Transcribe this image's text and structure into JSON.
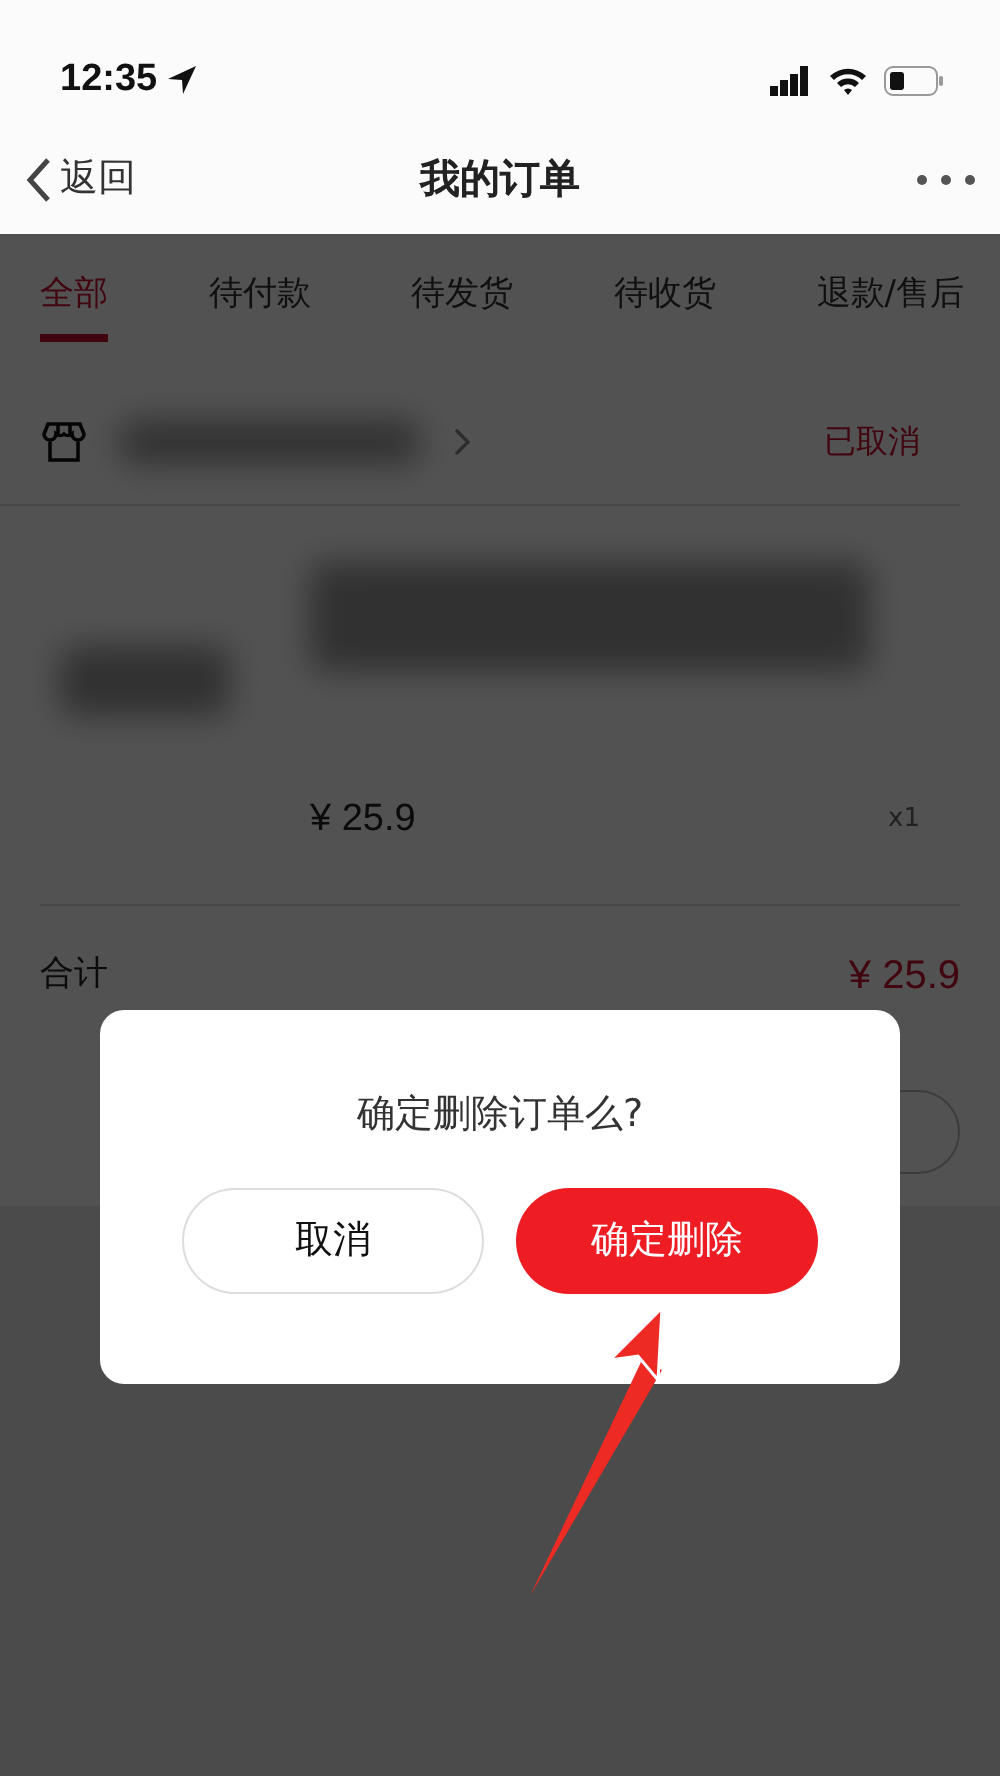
{
  "status_bar": {
    "time": "12:35"
  },
  "nav": {
    "back": "返回",
    "title": "我的订单"
  },
  "tabs": [
    {
      "label": "全部",
      "selected": true
    },
    {
      "label": "待付款",
      "selected": false
    },
    {
      "label": "待发货",
      "selected": false
    },
    {
      "label": "待收货",
      "selected": false
    },
    {
      "label": "退款/售后",
      "selected": false
    }
  ],
  "order": {
    "status": "已取消",
    "price": "¥ 25.9",
    "quantity": "x1",
    "total_label": "合计",
    "total": "¥ 25.9"
  },
  "dialog": {
    "message": "确定删除订单么?",
    "buttons": [
      {
        "label": "取消",
        "kind": "secondary"
      },
      {
        "label": "确定删除",
        "kind": "primary"
      }
    ]
  }
}
